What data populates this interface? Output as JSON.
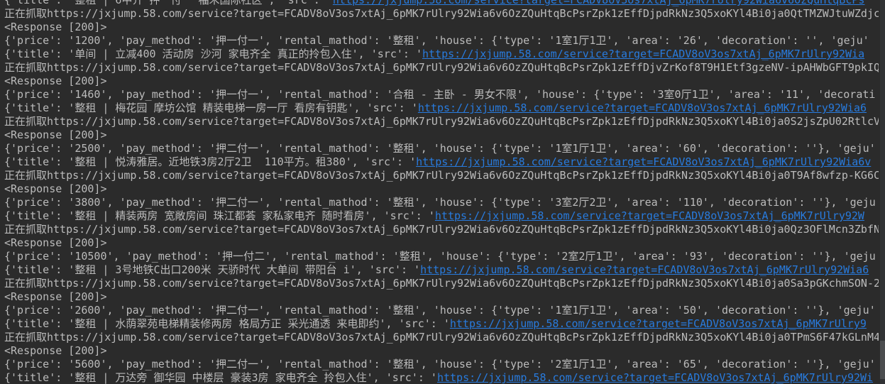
{
  "console": {
    "lines": [
      {
        "type": "record",
        "text": "{'title': '整租 | 6中介 押一付一 福禾国际社区', 'src': '",
        "link": "https://jxjump.58.com/service?target=FCADV8oV3os7xtAj_6pMK7rUlry92Wia6v6OzQuHtqBcPs"
      },
      {
        "type": "log",
        "text": "正在抓取https://jxjump.58.com/service?target=FCADV8oV3os7xtAj_6pMK7rUlry92Wia6v6OzZQuHtqBcPsrZpk1zEffDjpdRkNz3Q5xoKYl4Bi0ja0QtTMZWJtuWZdjc"
      },
      {
        "type": "log",
        "text": "<Response [200]>"
      },
      {
        "type": "log",
        "text": "{'price': '1200', 'pay_method': '押一付一', 'rental_mathod': '整租', 'house': {'type': '1室1厅1卫', 'area': '26', 'decoration': '', 'geju'"
      },
      {
        "type": "record",
        "text": "{'title': '单间 | 立减400 活动房 沙河 家电齐全 真正的拎包入住', 'src': '",
        "link": "https://jxjump.58.com/service?target=FCADV8oV3os7xtAj_6pMK7rUlry92Wia"
      },
      {
        "type": "log",
        "text": "正在抓取https://jxjump.58.com/service?target=FCADV8oV3os7xtAj_6pMK7rUlry92Wia6v6OzZQuHtqBcPsrZpk1zEffDjvZrKof8T9H1Etf3gzeNV-ipAHWbGFT9pkIQ"
      },
      {
        "type": "log",
        "text": "<Response [200]>"
      },
      {
        "type": "log",
        "text": "{'price': '1460', 'pay_method': '押一付一', 'rental_mathod': '合租 - 主卧 - 男女不限', 'house': {'type': '3室0厅1卫', 'area': '11', 'decorati"
      },
      {
        "type": "record",
        "text": "{'title': '整租 | 梅花园 摩坊公馆 精装电梯一房一厅 看房有钥匙', 'src': '",
        "link": "https://jxjump.58.com/service?target=FCADV8oV3os7xtAj_6pMK7rUlry92Wia6"
      },
      {
        "type": "log",
        "text": "正在抓取https://jxjump.58.com/service?target=FCADV8oV3os7xtAj_6pMK7rUlry92Wia6v6OzZQuHtqBcPsrZpk1zEffDjpdRkNz3Q5xoKYl4Bi0ja0S2jsZpU02RtlcV"
      },
      {
        "type": "log",
        "text": "<Response [200]>"
      },
      {
        "type": "log",
        "text": "{'price': '2500', 'pay_method': '押二付一', 'rental_mathod': '整租', 'house': {'type': '1室1厅1卫', 'area': '60', 'decoration': ''}, 'geju'"
      },
      {
        "type": "record",
        "text": "{'title': '整租 | 悦涛雅居。近地铁3房2厅2卫  110平方。租380', 'src': '",
        "link": "https://jxjump.58.com/service?target=FCADV8oV3os7xtAj_6pMK7rUlry92Wia6v"
      },
      {
        "type": "log",
        "text": "正在抓取https://jxjump.58.com/service?target=FCADV8oV3os7xtAj_6pMK7rUlry92Wia6v6OzZQuHtqBcPsrZpk1zEffDjpdRkNz3Q5xoKYl4Bi0ja0T9Af8wfzp-KG6C"
      },
      {
        "type": "log",
        "text": "<Response [200]>"
      },
      {
        "type": "log",
        "text": "{'price': '3800', 'pay_method': '押二付一', 'rental_mathod': '整租', 'house': {'type': '3室2厅2卫', 'area': '110', 'decoration': ''}, 'geju"
      },
      {
        "type": "record",
        "text": "{'title': '整租 | 精装两房 宽敞房间 珠江都荟 家私家电齐 随时看房', 'src': '",
        "link": "https://jxjump.58.com/service?target=FCADV8oV3os7xtAj_6pMK7rUlry92W"
      },
      {
        "type": "log",
        "text": "正在抓取https://jxjump.58.com/service?target=FCADV8oV3os7xtAj_6pMK7rUlry92Wia6v6OzZQuHtqBcPsrZpk1zEffDjpdRkNz3Q5xoKYl4Bi0ja0Qz3OFlMcn3ZbfN"
      },
      {
        "type": "log",
        "text": "<Response [200]>"
      },
      {
        "type": "log",
        "text": "{'price': '10500', 'pay_method': '押一付二', 'rental_mathod': '整租', 'house': {'type': '2室2厅1卫', 'area': '93', 'decoration': ''}, 'geju"
      },
      {
        "type": "record",
        "text": "{'title': '整租 | 3号地铁C出口200米 天骄时代 大单间 带阳台 i', 'src': '",
        "link": "https://jxjump.58.com/service?target=FCADV8oV3os7xtAj_6pMK7rUlry92Wia6"
      },
      {
        "type": "log",
        "text": "正在抓取https://jxjump.58.com/service?target=FCADV8oV3os7xtAj_6pMK7rUlry92Wia6v6OzZQuHtqBcPsrZpk1zEffDjpdRkNz3Q5xoKYl4Bi0ja0Sa3pGKchmSON-2"
      },
      {
        "type": "log",
        "text": "<Response [200]>"
      },
      {
        "type": "log",
        "text": "{'price': '2600', 'pay_method': '押二付一', 'rental_mathod': '整租', 'house': {'type': '1室1厅1卫', 'area': '50', 'decoration': ''}, 'geju'"
      },
      {
        "type": "record",
        "text": "{'title': '整租 | 水荫翠苑电梯精装修两房 格局方正 采光通透 来电即约', 'src': '",
        "link": "https://jxjump.58.com/service?target=FCADV8oV3os7xtAj_6pMK7rUlry9"
      },
      {
        "type": "log",
        "text": "正在抓取https://jxjump.58.com/service?target=FCADV8oV3os7xtAj_6pMK7rUlry92Wia6v6OzZQuHtqBcPsrZpk1zEffDjpdRkNz3Q5xoKYl4Bi0ja0TPmS6F47kGLnM4"
      },
      {
        "type": "log",
        "text": "<Response [200]>"
      },
      {
        "type": "log",
        "text": "{'price': '5600', 'pay_method': '押二付一', 'rental_mathod': '整租', 'house': {'type': '2室1厅1卫', 'area': '65', 'decoration': ''}, 'geju'"
      },
      {
        "type": "record",
        "text": "{'title': '整租 | 万达旁 御华园 中楼层 豪装3房 家电齐全 拎包入住', 'src': '",
        "link": "https://jxjump.58.com/service?target=FCADV8oV3os7xtAj_6pMK7rUlry92Wi"
      }
    ],
    "right_edge_chars": [
      "U",
      "M",
      "",
      "",
      "s",
      "h"
    ]
  }
}
